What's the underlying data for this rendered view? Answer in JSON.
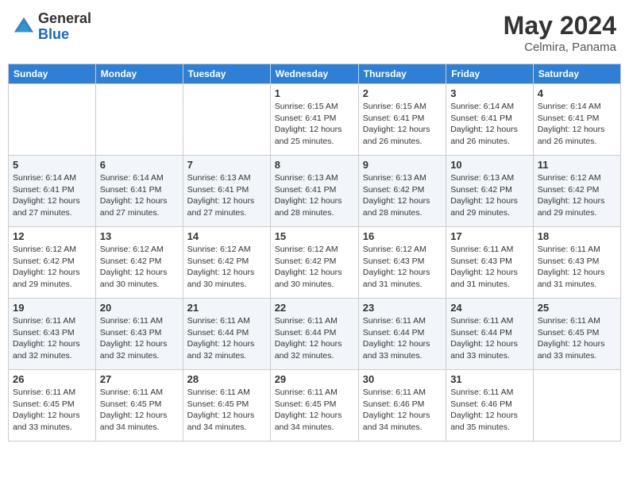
{
  "header": {
    "logo_general": "General",
    "logo_blue": "Blue",
    "month_year": "May 2024",
    "location": "Celmira, Panama"
  },
  "days_of_week": [
    "Sunday",
    "Monday",
    "Tuesday",
    "Wednesday",
    "Thursday",
    "Friday",
    "Saturday"
  ],
  "weeks": [
    [
      {
        "day": "",
        "sunrise": "",
        "sunset": "",
        "daylight": ""
      },
      {
        "day": "",
        "sunrise": "",
        "sunset": "",
        "daylight": ""
      },
      {
        "day": "",
        "sunrise": "",
        "sunset": "",
        "daylight": ""
      },
      {
        "day": "1",
        "sunrise": "Sunrise: 6:15 AM",
        "sunset": "Sunset: 6:41 PM",
        "daylight": "Daylight: 12 hours and 25 minutes."
      },
      {
        "day": "2",
        "sunrise": "Sunrise: 6:15 AM",
        "sunset": "Sunset: 6:41 PM",
        "daylight": "Daylight: 12 hours and 26 minutes."
      },
      {
        "day": "3",
        "sunrise": "Sunrise: 6:14 AM",
        "sunset": "Sunset: 6:41 PM",
        "daylight": "Daylight: 12 hours and 26 minutes."
      },
      {
        "day": "4",
        "sunrise": "Sunrise: 6:14 AM",
        "sunset": "Sunset: 6:41 PM",
        "daylight": "Daylight: 12 hours and 26 minutes."
      }
    ],
    [
      {
        "day": "5",
        "sunrise": "Sunrise: 6:14 AM",
        "sunset": "Sunset: 6:41 PM",
        "daylight": "Daylight: 12 hours and 27 minutes."
      },
      {
        "day": "6",
        "sunrise": "Sunrise: 6:14 AM",
        "sunset": "Sunset: 6:41 PM",
        "daylight": "Daylight: 12 hours and 27 minutes."
      },
      {
        "day": "7",
        "sunrise": "Sunrise: 6:13 AM",
        "sunset": "Sunset: 6:41 PM",
        "daylight": "Daylight: 12 hours and 27 minutes."
      },
      {
        "day": "8",
        "sunrise": "Sunrise: 6:13 AM",
        "sunset": "Sunset: 6:41 PM",
        "daylight": "Daylight: 12 hours and 28 minutes."
      },
      {
        "day": "9",
        "sunrise": "Sunrise: 6:13 AM",
        "sunset": "Sunset: 6:42 PM",
        "daylight": "Daylight: 12 hours and 28 minutes."
      },
      {
        "day": "10",
        "sunrise": "Sunrise: 6:13 AM",
        "sunset": "Sunset: 6:42 PM",
        "daylight": "Daylight: 12 hours and 29 minutes."
      },
      {
        "day": "11",
        "sunrise": "Sunrise: 6:12 AM",
        "sunset": "Sunset: 6:42 PM",
        "daylight": "Daylight: 12 hours and 29 minutes."
      }
    ],
    [
      {
        "day": "12",
        "sunrise": "Sunrise: 6:12 AM",
        "sunset": "Sunset: 6:42 PM",
        "daylight": "Daylight: 12 hours and 29 minutes."
      },
      {
        "day": "13",
        "sunrise": "Sunrise: 6:12 AM",
        "sunset": "Sunset: 6:42 PM",
        "daylight": "Daylight: 12 hours and 30 minutes."
      },
      {
        "day": "14",
        "sunrise": "Sunrise: 6:12 AM",
        "sunset": "Sunset: 6:42 PM",
        "daylight": "Daylight: 12 hours and 30 minutes."
      },
      {
        "day": "15",
        "sunrise": "Sunrise: 6:12 AM",
        "sunset": "Sunset: 6:42 PM",
        "daylight": "Daylight: 12 hours and 30 minutes."
      },
      {
        "day": "16",
        "sunrise": "Sunrise: 6:12 AM",
        "sunset": "Sunset: 6:43 PM",
        "daylight": "Daylight: 12 hours and 31 minutes."
      },
      {
        "day": "17",
        "sunrise": "Sunrise: 6:11 AM",
        "sunset": "Sunset: 6:43 PM",
        "daylight": "Daylight: 12 hours and 31 minutes."
      },
      {
        "day": "18",
        "sunrise": "Sunrise: 6:11 AM",
        "sunset": "Sunset: 6:43 PM",
        "daylight": "Daylight: 12 hours and 31 minutes."
      }
    ],
    [
      {
        "day": "19",
        "sunrise": "Sunrise: 6:11 AM",
        "sunset": "Sunset: 6:43 PM",
        "daylight": "Daylight: 12 hours and 32 minutes."
      },
      {
        "day": "20",
        "sunrise": "Sunrise: 6:11 AM",
        "sunset": "Sunset: 6:43 PM",
        "daylight": "Daylight: 12 hours and 32 minutes."
      },
      {
        "day": "21",
        "sunrise": "Sunrise: 6:11 AM",
        "sunset": "Sunset: 6:44 PM",
        "daylight": "Daylight: 12 hours and 32 minutes."
      },
      {
        "day": "22",
        "sunrise": "Sunrise: 6:11 AM",
        "sunset": "Sunset: 6:44 PM",
        "daylight": "Daylight: 12 hours and 32 minutes."
      },
      {
        "day": "23",
        "sunrise": "Sunrise: 6:11 AM",
        "sunset": "Sunset: 6:44 PM",
        "daylight": "Daylight: 12 hours and 33 minutes."
      },
      {
        "day": "24",
        "sunrise": "Sunrise: 6:11 AM",
        "sunset": "Sunset: 6:44 PM",
        "daylight": "Daylight: 12 hours and 33 minutes."
      },
      {
        "day": "25",
        "sunrise": "Sunrise: 6:11 AM",
        "sunset": "Sunset: 6:45 PM",
        "daylight": "Daylight: 12 hours and 33 minutes."
      }
    ],
    [
      {
        "day": "26",
        "sunrise": "Sunrise: 6:11 AM",
        "sunset": "Sunset: 6:45 PM",
        "daylight": "Daylight: 12 hours and 33 minutes."
      },
      {
        "day": "27",
        "sunrise": "Sunrise: 6:11 AM",
        "sunset": "Sunset: 6:45 PM",
        "daylight": "Daylight: 12 hours and 34 minutes."
      },
      {
        "day": "28",
        "sunrise": "Sunrise: 6:11 AM",
        "sunset": "Sunset: 6:45 PM",
        "daylight": "Daylight: 12 hours and 34 minutes."
      },
      {
        "day": "29",
        "sunrise": "Sunrise: 6:11 AM",
        "sunset": "Sunset: 6:45 PM",
        "daylight": "Daylight: 12 hours and 34 minutes."
      },
      {
        "day": "30",
        "sunrise": "Sunrise: 6:11 AM",
        "sunset": "Sunset: 6:46 PM",
        "daylight": "Daylight: 12 hours and 34 minutes."
      },
      {
        "day": "31",
        "sunrise": "Sunrise: 6:11 AM",
        "sunset": "Sunset: 6:46 PM",
        "daylight": "Daylight: 12 hours and 35 minutes."
      },
      {
        "day": "",
        "sunrise": "",
        "sunset": "",
        "daylight": ""
      }
    ]
  ]
}
